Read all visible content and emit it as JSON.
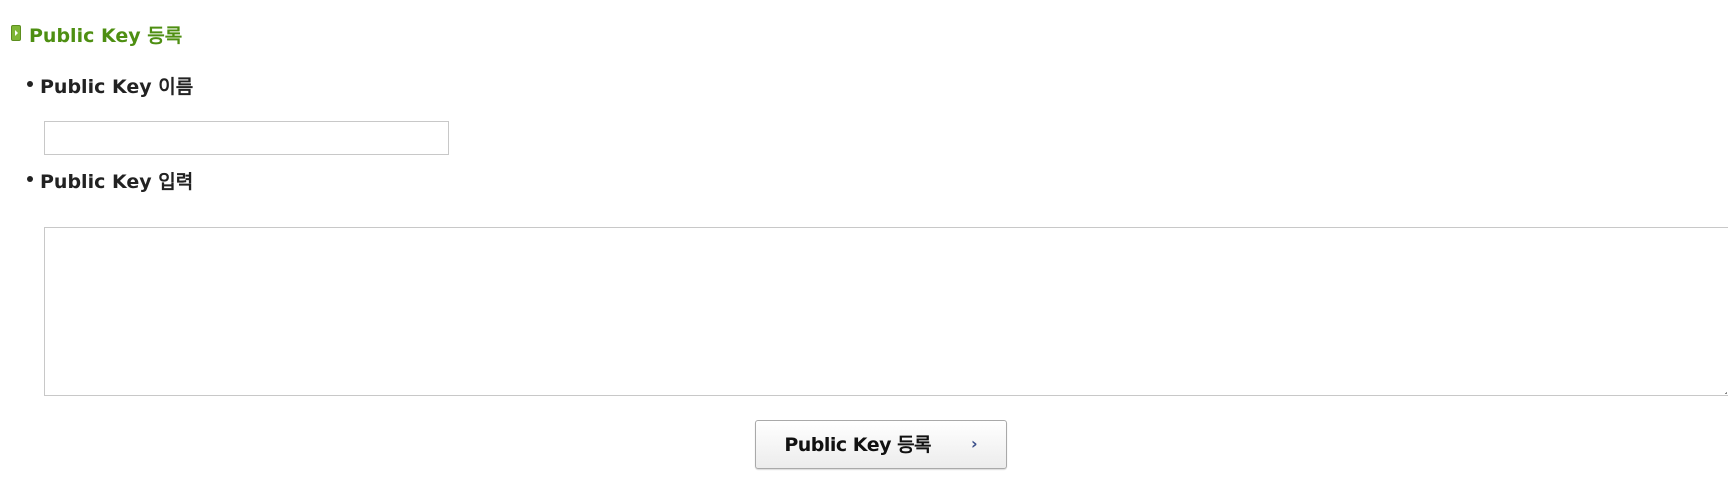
{
  "section": {
    "title": "Public Key 등록",
    "icon": "green-arrow-box-icon",
    "color": "#4e8f12"
  },
  "fields": {
    "name_label": "Public Key 이름",
    "name_value": "",
    "key_label": "Public Key 입력",
    "key_value": ""
  },
  "actions": {
    "submit_label": "Public Key 등록",
    "submit_icon": "chevron-right-icon",
    "submit_glyph": "›"
  }
}
